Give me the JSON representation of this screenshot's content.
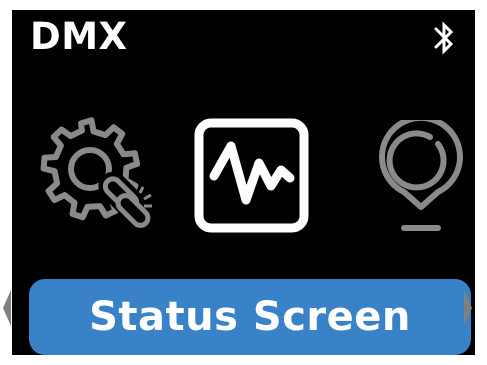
{
  "header": {
    "title": "DMX",
    "bluetooth_icon": "bluetooth-icon"
  },
  "menu": {
    "items": [
      {
        "icon": "settings-link-icon",
        "state": "unselected"
      },
      {
        "icon": "activity-waveform-icon",
        "state": "selected"
      },
      {
        "icon": "location-pin-icon",
        "state": "unselected"
      }
    ],
    "selected_label": "Status Screen",
    "nav_left_icon": "left-arrow-icon",
    "nav_right_icon": "right-arrow-icon"
  },
  "colors": {
    "background": "#000000",
    "selected_icon": "#ffffff",
    "unselected_icon": "#8a8a8a",
    "label_bar": "#3a82c8",
    "label_text": "#ffffff",
    "nav_arrow": "#808080"
  }
}
